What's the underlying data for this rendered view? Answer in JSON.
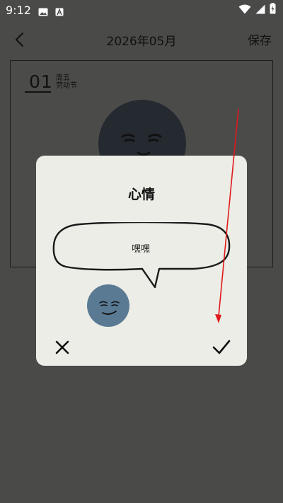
{
  "status_bar": {
    "time": "9:12",
    "icons": [
      "image-icon",
      "font-icon",
      "wifi-icon",
      "signal-icon",
      "battery-icon"
    ]
  },
  "app_bar": {
    "back_icon": "chevron-left-icon",
    "title": "2026年05月",
    "save_label": "保存"
  },
  "diary": {
    "day": "01",
    "weekday": "周五",
    "holiday": "劳动节"
  },
  "dialog": {
    "title": "心情",
    "mood_text": "嘿嘿",
    "cancel_icon": "close-icon",
    "confirm_icon": "check-icon"
  },
  "colors": {
    "background": "#4a4a49",
    "dialog": "#ecede6",
    "big_face": "#252a31",
    "mood_face": "#5a7a94",
    "arrow": "#e0191d"
  }
}
